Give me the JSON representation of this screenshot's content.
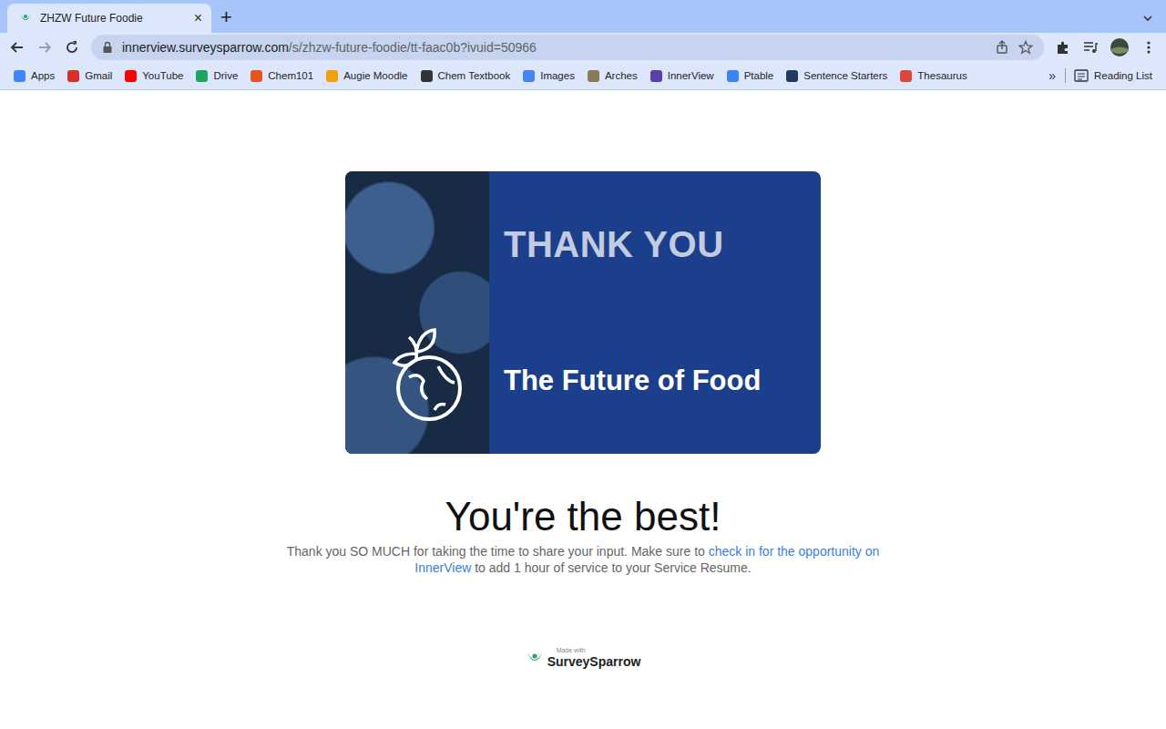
{
  "window": {
    "tabs": [
      {
        "title": "ZHZW Future Foodie",
        "selected": true,
        "close": "×"
      }
    ],
    "new_tab": "+"
  },
  "toolbar": {
    "url_host": "innerview.surveysparrow.com",
    "url_path": "/s/zhzw-future-foodie/tt-faac0b?ivuid=50966"
  },
  "bookmarks": {
    "items": [
      {
        "label": "Apps",
        "color": "#4285f4"
      },
      {
        "label": "Gmail",
        "color": "#d93025"
      },
      {
        "label": "YouTube",
        "color": "#ff0000"
      },
      {
        "label": "Drive",
        "color": "#1fa463"
      },
      {
        "label": "Chem101",
        "color": "#e8541e"
      },
      {
        "label": "Augie Moodle",
        "color": "#f59e0b"
      },
      {
        "label": "Chem Textbook",
        "color": "#333333"
      },
      {
        "label": "Images",
        "color": "#4285f4"
      },
      {
        "label": "Arches",
        "color": "#8a7a5a"
      },
      {
        "label": "InnerView",
        "color": "#5b3fa8"
      },
      {
        "label": "Ptable",
        "color": "#3b82f6"
      },
      {
        "label": "Sentence Starters",
        "color": "#1e3a5f"
      },
      {
        "label": "Thesaurus",
        "color": "#e0453a"
      }
    ],
    "overflow": "»",
    "reading_list": "Reading List"
  },
  "page": {
    "banner": {
      "title": "THANK YOU",
      "subtitle": "The Future of Food"
    },
    "heading": "You're the best!",
    "message_before": "Thank you SO MUCH for taking the time to share your input. Make sure to ",
    "link": "check in for the opportunity on InnerView",
    "message_after": " to add 1 hour of service to your Service Resume.",
    "footer": {
      "made_with": "Made with",
      "brand": "SurveySparrow"
    }
  }
}
